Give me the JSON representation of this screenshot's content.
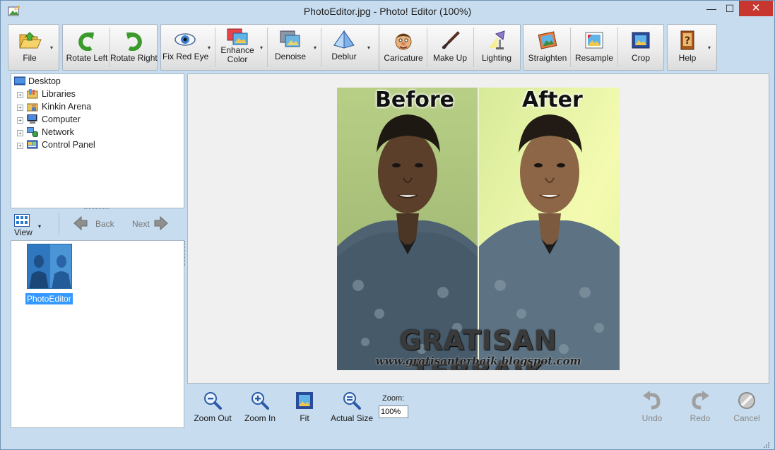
{
  "window": {
    "title": "PhotoEditor.jpg - Photo! Editor (100%)",
    "minimize": "—",
    "maximize": "☐",
    "close": "✕"
  },
  "toolbar": {
    "file": "File",
    "rotate_left": "Rotate Left",
    "rotate_right": "Rotate Right",
    "fix_red_eye": "Fix Red Eye",
    "enhance_color_1": "Enhance",
    "enhance_color_2": "Color",
    "denoise": "Denoise",
    "deblur": "Deblur",
    "caricature": "Caricature",
    "make_up": "Make Up",
    "lighting": "Lighting",
    "straighten": "Straighten",
    "resample": "Resample",
    "crop": "Crop",
    "help": "Help",
    "dropdown_glyph": "▾"
  },
  "tree": {
    "root": "Desktop",
    "items": [
      {
        "label": "Libraries",
        "icon": "libraries-icon"
      },
      {
        "label": "Kinkin Arena",
        "icon": "user-folder-icon"
      },
      {
        "label": "Computer",
        "icon": "computer-icon"
      },
      {
        "label": "Network",
        "icon": "network-icon"
      },
      {
        "label": "Control Panel",
        "icon": "control-panel-icon"
      }
    ],
    "expander": "+"
  },
  "nav": {
    "view": "View",
    "back": "Back",
    "next": "Next"
  },
  "thumbnails": [
    {
      "label": "PhotoEditor"
    }
  ],
  "preview": {
    "label_before": "Before",
    "label_after": "After",
    "watermark": "GRATISAN TERBAIK",
    "watermark_url": "www.gratisanterbaik.blogspot.com"
  },
  "bottom": {
    "zoom_out": "Zoom Out",
    "zoom_in": "Zoom In",
    "fit": "Fit",
    "actual_size": "Actual Size",
    "zoom_label": "Zoom:",
    "zoom_value": "100%",
    "undo": "Undo",
    "redo": "Redo",
    "cancel": "Cancel"
  },
  "colors": {
    "frame": "#c7dcee",
    "close_button": "#c7372f",
    "selection": "#3399ff",
    "before_bg": "#a9c27b",
    "after_bg": "#e9f5a3"
  }
}
